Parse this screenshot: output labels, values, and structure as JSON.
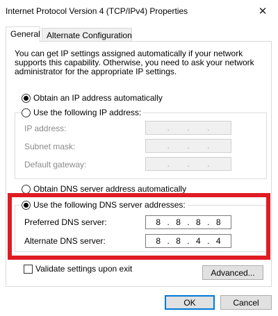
{
  "window": {
    "title": "Internet Protocol Version 4 (TCP/IPv4) Properties",
    "close_glyph": "✕"
  },
  "tabs": [
    {
      "label": "General",
      "active": true
    },
    {
      "label": "Alternate Configuration",
      "active": false
    }
  ],
  "description": "You can get IP settings assigned automatically if your network supports this capability. Otherwise, you need to ask your network administrator for the appropriate IP settings.",
  "ip": {
    "auto_label": "Obtain an IP address automatically",
    "auto_selected": true,
    "manual_label": "Use the following IP address:",
    "manual_selected": false,
    "fields": [
      {
        "label": "IP address:",
        "octets": [
          "",
          "",
          "",
          ""
        ]
      },
      {
        "label": "Subnet mask:",
        "octets": [
          "",
          "",
          "",
          ""
        ]
      },
      {
        "label": "Default gateway:",
        "octets": [
          "",
          "",
          "",
          ""
        ]
      }
    ]
  },
  "dns": {
    "auto_label": "Obtain DNS server address automatically",
    "auto_selected": false,
    "manual_label": "Use the following DNS server addresses:",
    "manual_selected": true,
    "preferred": {
      "label": "Preferred DNS server:",
      "octets": [
        "8",
        "8",
        "8",
        "8"
      ]
    },
    "alternate": {
      "label": "Alternate DNS server:",
      "octets": [
        "8",
        "8",
        "4",
        "4"
      ]
    }
  },
  "validate": {
    "label": "Validate settings upon exit",
    "checked": false
  },
  "buttons": {
    "advanced": "Advanced...",
    "ok": "OK",
    "cancel": "Cancel"
  },
  "colors": {
    "highlight": "#e01b24",
    "default_button_border": "#0078d7"
  }
}
